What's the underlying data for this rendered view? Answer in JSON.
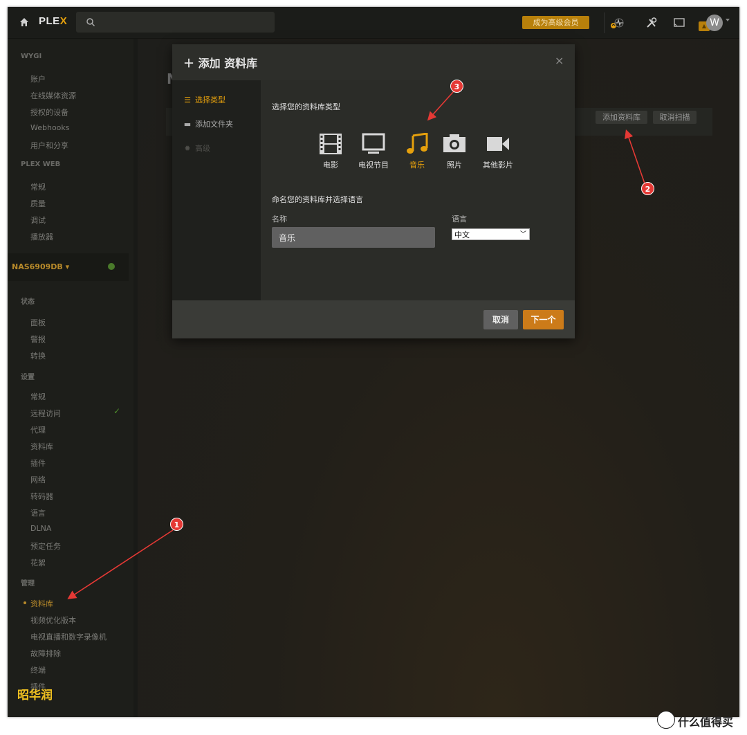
{
  "topbar": {
    "logo_main": "PLE",
    "logo_x": "X",
    "premium_label": "成为高级会员",
    "avatar_letter": "W"
  },
  "sidebar": {
    "section_account": "WYGI",
    "account_items": [
      "账户",
      "在线媒体资源",
      "授权的设备",
      "Webhooks",
      "用户和分享"
    ],
    "section_web": "PLEX WEB",
    "web_items": [
      "常规",
      "质量",
      "调试",
      "播放器"
    ],
    "server_name": "NAS6909DB ▾",
    "section_status": "状态",
    "status_items": [
      "面板",
      "警报",
      "转换"
    ],
    "section_settings": "设置",
    "settings_items": [
      "常规",
      "远程访问",
      "代理",
      "资料库",
      "插件",
      "网络",
      "转码器",
      "语言",
      "DLNA",
      "预定任务",
      "花絮"
    ],
    "section_manage": "管理",
    "manage_items": [
      "资料库",
      "视频优化版本",
      "电视直播和数字录像机",
      "故障排除",
      "终端",
      "插件"
    ]
  },
  "main": {
    "title": "N",
    "add_library_button": "添加资料库",
    "cancel_scan_button": "取消扫描"
  },
  "modal": {
    "title": "添加 资料库",
    "close": "×",
    "nav": [
      "选择类型",
      "添加文件夹",
      "高级"
    ],
    "select_type_heading": "选择您的资料库类型",
    "types": [
      "电影",
      "电视节目",
      "音乐",
      "照片",
      "其他影片"
    ],
    "active_type": "音乐",
    "name_heading": "命名您的资料库并选择语言",
    "name_label": "名称",
    "name_value": "音乐",
    "language_label": "语言",
    "language_value": "中文",
    "cancel_button": "取消",
    "next_button": "下一个"
  },
  "annotations": [
    "1",
    "2",
    "3"
  ],
  "watermark": {
    "logo": "昭华润",
    "corner": "什么值得买"
  },
  "colors": {
    "accent": "#e5a00d",
    "next_button": "#cc7b19",
    "marker": "#e53935"
  }
}
